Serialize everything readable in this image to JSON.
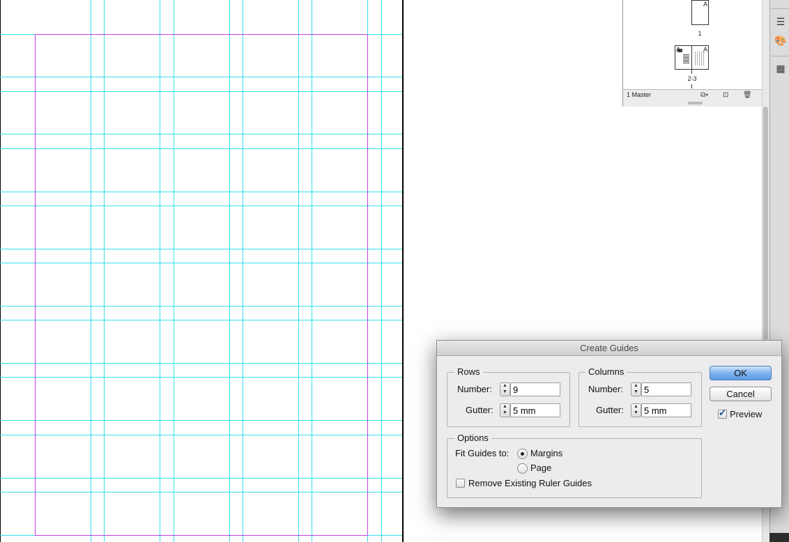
{
  "pages_panel": {
    "thumbnails": [
      {
        "number": "1",
        "master": "A"
      },
      {
        "number": "2-3",
        "master_left": "A",
        "master_right": "A"
      }
    ],
    "status": "1 Master",
    "icons": [
      "new-page-icon",
      "create-page-icon",
      "trash-icon"
    ]
  },
  "toolstrip": {
    "icons": [
      "lines-icon",
      "swatches-icon",
      "table-icon"
    ]
  },
  "dialog": {
    "title": "Create Guides",
    "rows": {
      "legend": "Rows",
      "number_label": "Number:",
      "number_value": "9",
      "gutter_label": "Gutter:",
      "gutter_value": "5 mm"
    },
    "columns": {
      "legend": "Columns",
      "number_label": "Number:",
      "number_value": "5",
      "gutter_label": "Gutter:",
      "gutter_value": "5 mm"
    },
    "options": {
      "legend": "Options",
      "fit_label": "Fit Guides to:",
      "fit_options": [
        "Margins",
        "Page"
      ],
      "fit_selected": "Margins",
      "remove_label": "Remove Existing Ruler Guides",
      "remove_checked": false
    },
    "buttons": {
      "ok": "OK",
      "cancel": "Cancel"
    },
    "preview_label": "Preview",
    "preview_checked": true
  },
  "colors": {
    "guide": "#33e0e8",
    "margin": "#c33ce0",
    "default_button": "#5d9be6"
  }
}
